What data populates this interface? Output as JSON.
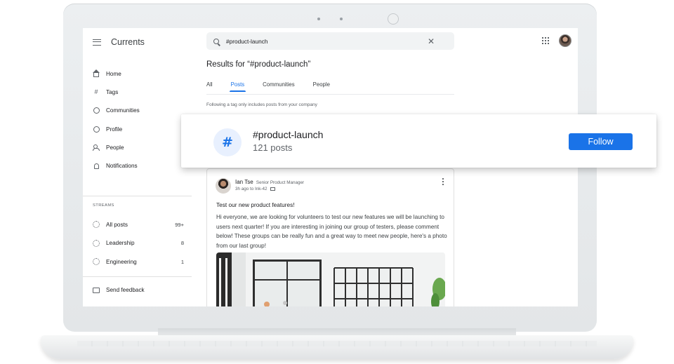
{
  "app": {
    "title": "Currents"
  },
  "search": {
    "query": "#product-launch"
  },
  "results": {
    "title": "Results for “#product-launch”"
  },
  "tabs": [
    {
      "label": "All"
    },
    {
      "label": "Posts",
      "active": true
    },
    {
      "label": "Communities"
    },
    {
      "label": "People"
    }
  ],
  "hint": "Following a tag only includes posts from your company",
  "nav": [
    {
      "label": "Home",
      "icon": "home-icon"
    },
    {
      "label": "Tags",
      "icon": "hash-icon"
    },
    {
      "label": "Communities",
      "icon": "communities-icon"
    },
    {
      "label": "Profile",
      "icon": "profile-icon"
    },
    {
      "label": "People",
      "icon": "people-icon"
    },
    {
      "label": "Notifications",
      "icon": "bell-icon"
    }
  ],
  "streams": {
    "label": "STREAMS",
    "items": [
      {
        "label": "All posts",
        "count": "99+"
      },
      {
        "label": "Leadership",
        "count": "8"
      },
      {
        "label": "Engineering",
        "count": "1"
      }
    ]
  },
  "feedback": {
    "label": "Send feedback"
  },
  "tag_card": {
    "name": "#product-launch",
    "count": "121 posts",
    "follow_label": "Follow"
  },
  "post": {
    "author": "Ian Tse",
    "role": "Senior Product Manager",
    "meta": "3h ago to Ink-42",
    "title": "Test our new product features!",
    "body": "Hi everyone, we are looking for volunteers to test our new features we will be launching to users next quarter! If you are interesting in joining our group of testers, please comment below! These groups can be really fun and a great way to meet new people, here's a photo from our last group!"
  },
  "colors": {
    "accent": "#1a73e8",
    "accent_light": "#e8f0fe",
    "text": "#202124",
    "secondary_text": "#5f6368"
  }
}
